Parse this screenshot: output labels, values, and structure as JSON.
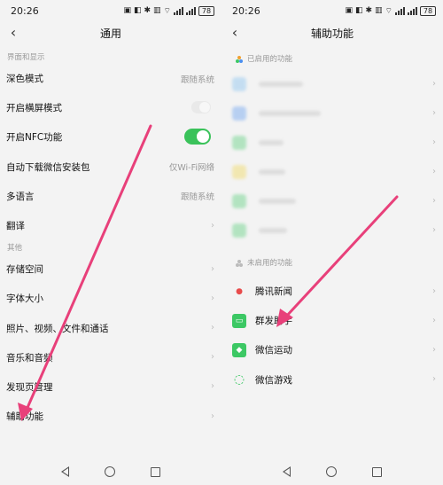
{
  "left": {
    "status": {
      "time": "20:26",
      "battery": "78"
    },
    "title": "通用",
    "section1": "界面和显示",
    "items1": [
      {
        "label": "深色模式",
        "value": "跟随系统"
      },
      {
        "label": "开启横屏模式",
        "value": ""
      },
      {
        "label": "开启NFC功能",
        "value": ""
      },
      {
        "label": "自动下载微信安装包",
        "value": "仅Wi-Fi网络"
      },
      {
        "label": "多语言",
        "value": "跟随系统"
      },
      {
        "label": "翻译",
        "value": ""
      }
    ],
    "section2": "其他",
    "items2": [
      {
        "label": "存储空间"
      },
      {
        "label": "字体大小"
      },
      {
        "label": "照片、视频、文件和通话"
      },
      {
        "label": "音乐和音频"
      },
      {
        "label": "发现页管理"
      },
      {
        "label": "辅助功能"
      }
    ],
    "toggles": {
      "landscape": false,
      "nfc": true
    }
  },
  "right": {
    "status": {
      "time": "20:26",
      "battery": "78"
    },
    "title": "辅助功能",
    "enabled_section": "已启用的功能",
    "disabled_section": "未启用的功能",
    "enabled_blur_colors": [
      "#6fb7f0",
      "#4a8ef0",
      "#3cc864",
      "#f0d23a",
      "#3cc864",
      "#3cc864"
    ],
    "disabled_items": [
      {
        "label": "腾讯新闻",
        "icon": "tencent-news-icon",
        "color": "#e84b4b"
      },
      {
        "label": "群发助手",
        "icon": "mass-send-icon",
        "color": "#3cc864"
      },
      {
        "label": "微信运动",
        "icon": "wechat-sport-icon",
        "color": "#3cc864"
      },
      {
        "label": "微信游戏",
        "icon": "wechat-game-icon",
        "color": "#3cc864"
      }
    ]
  },
  "colors": {
    "toggle_on": "#3ac25a",
    "arrow": "#e8407a"
  }
}
